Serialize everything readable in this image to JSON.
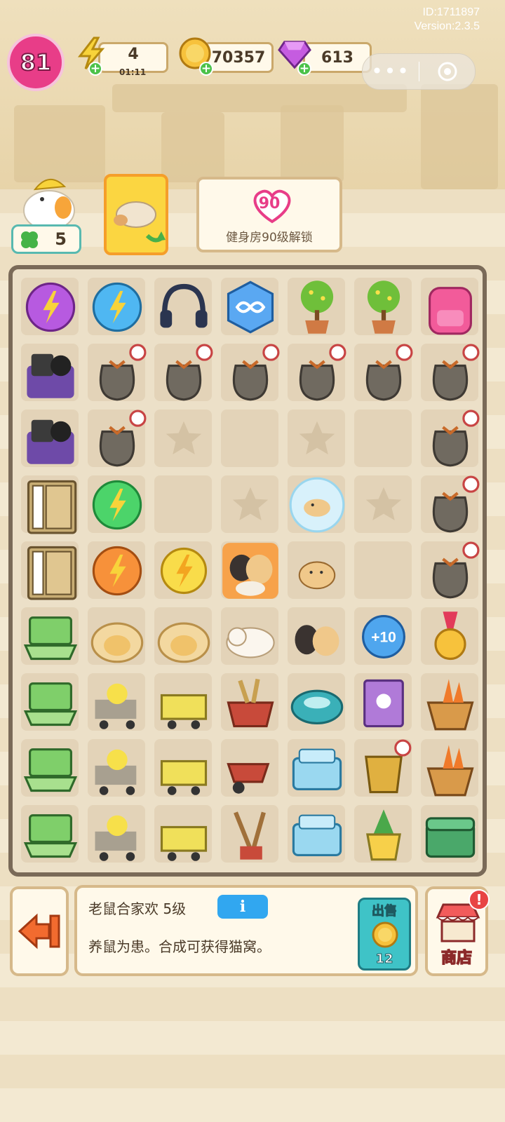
{
  "meta": {
    "id_line": "ID:1711897",
    "version_line": "Version:2.3.5"
  },
  "hud": {
    "level": "81",
    "energy": "4",
    "energy_timer": "01:11",
    "coins": "70357",
    "gems": "613",
    "clovers": "5"
  },
  "unlock": {
    "heart_level": "90",
    "text": "健身房90级解锁"
  },
  "selected_item": {
    "title": "老鼠合家欢 5级",
    "description": "养鼠为患。合成可获得猫窝。",
    "sell_label": "出售",
    "sell_price": "12"
  },
  "buttons": {
    "shop_label": "商店",
    "alert": "!",
    "info_symbol": "i"
  },
  "colors": {
    "accent_pink": "#e83d88",
    "teal": "#3fc3c7",
    "board_frame": "#7a6a58"
  },
  "board": {
    "cols": 7,
    "rows": 9,
    "items": [
      [
        "energy-orb-purple",
        "energy-orb-blue",
        "headphones",
        "infinity-hexagon",
        "flower-pot",
        "flower-pot",
        "pink-backpack"
      ],
      [
        "junk-pile",
        "trash-bag",
        "trash-bag",
        "trash-bag",
        "trash-bag",
        "trash-bag",
        "trash-bag"
      ],
      [
        "junk-pile",
        "trash-bag",
        "empty-star",
        "empty",
        "empty-star",
        "empty",
        "trash-bag"
      ],
      [
        "wooden-cabinet",
        "energy-orb-green",
        "empty",
        "empty-star",
        "hamster-bubble",
        "empty-star",
        "trash-bag"
      ],
      [
        "wooden-cabinet",
        "energy-orb-orange",
        "energy-orb-yellow",
        "hamster-family",
        "hamster",
        "empty",
        "trash-bag"
      ],
      [
        "laptop",
        "cat-bed",
        "cat-bed",
        "white-cat",
        "hamster-pair",
        "plus-10-token",
        "gold-medal"
      ],
      [
        "laptop",
        "duck-cart",
        "cart",
        "basket",
        "robot-vacuum",
        "book",
        "carrot-basket"
      ],
      [
        "laptop",
        "duck-cart",
        "cart",
        "wheelbarrow",
        "ice-box",
        "bucket",
        "carrot-basket"
      ],
      [
        "laptop",
        "duck-cart",
        "cart",
        "broom-tools",
        "ice-box",
        "plant-pot",
        "green-chest"
      ]
    ]
  }
}
